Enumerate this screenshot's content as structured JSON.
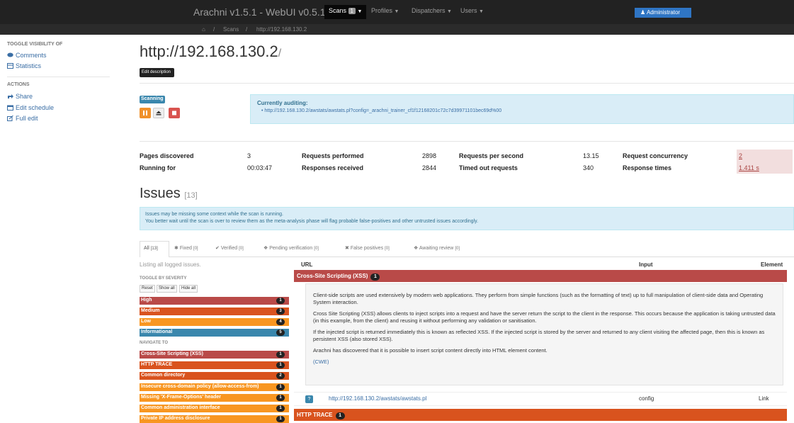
{
  "navbar": {
    "brand": "Arachni v1.5.1 - WebUI v0.5.12",
    "items": [
      {
        "label": "Scans",
        "badge": "1"
      },
      {
        "label": "Profiles"
      },
      {
        "label": "Dispatchers"
      },
      {
        "label": "Users"
      }
    ],
    "user": "Administrator"
  },
  "breadcrumb": [
    "Scans",
    "http://192.168.130.2"
  ],
  "sidebar": {
    "toggle_heading": "TOGGLE VISIBILITY OF",
    "toggle_items": [
      "Comments",
      "Statistics"
    ],
    "actions_heading": "ACTIONS",
    "actions": [
      "Share",
      "Edit schedule",
      "Full edit"
    ]
  },
  "scan": {
    "title": "http://192.168.130.2",
    "edit_description": "Edit description",
    "status": "Scanning",
    "auditing_heading": "Currently auditing:",
    "auditing_url": "http://192.168.130.2/awstats/awstats.pl?config=_arachni_trainer_cf1f12168201c72c7d39971101bec69d%00"
  },
  "stats": [
    {
      "label": "Pages discovered",
      "value": "3"
    },
    {
      "label": "Requests performed",
      "value": "2898"
    },
    {
      "label": "Requests per second",
      "value": "13.15"
    },
    {
      "label": "Request concurrency",
      "value": "2"
    },
    {
      "label": "Running for",
      "value": "00:03:47"
    },
    {
      "label": "Responses received",
      "value": "2844"
    },
    {
      "label": "Timed out requests",
      "value": "340"
    },
    {
      "label": "Response times",
      "value": "1.411 s"
    }
  ],
  "issues": {
    "heading": "Issues",
    "count": "[13]",
    "warning_line1": "Issues may be missing some context while the scan is running.",
    "warning_line2": "You better wait until the scan is over to review them as the meta-analysis phase will flag probable false-positives and other untrusted issues accordingly.",
    "tabs": [
      {
        "label": "All",
        "count": "[13]"
      },
      {
        "label": "Fixed",
        "count": "[0]"
      },
      {
        "label": "Verified",
        "count": "[0]"
      },
      {
        "label": "Pending verification",
        "count": "[0]"
      },
      {
        "label": "False positives",
        "count": "[0]"
      },
      {
        "label": "Awaiting review",
        "count": "[0]"
      }
    ],
    "listing_text": "Listing all logged issues.",
    "columns": [
      "URL",
      "Input",
      "Element"
    ],
    "severity_heading": "TOGGLE BY SEVERITY",
    "severity_buttons": [
      "Reset",
      "Show all",
      "Hide all"
    ],
    "severities": [
      {
        "label": "High",
        "count": "1"
      },
      {
        "label": "Medium",
        "count": "3"
      },
      {
        "label": "Low",
        "count": "4"
      },
      {
        "label": "Informational",
        "count": "5"
      }
    ],
    "navigate_heading": "NAVIGATE TO",
    "navigate": [
      {
        "label": "Cross-Site Scripting (XSS)",
        "count": "1"
      },
      {
        "label": "HTTP TRACE",
        "count": "1"
      },
      {
        "label": "Common directory",
        "count": "2"
      },
      {
        "label": "Insecure cross-domain policy (allow-access-from)",
        "count": "1"
      },
      {
        "label": "Missing 'X-Frame-Options' header",
        "count": "1"
      },
      {
        "label": "Common administration interface",
        "count": "1"
      },
      {
        "label": "Private IP address disclosure",
        "count": "1"
      }
    ],
    "groups": [
      {
        "title": "Cross-Site Scripting (XSS)",
        "count": "1",
        "description": [
          "Client-side scripts are used extensively by modern web applications. They perform from simple functions (such as the formatting of text) up to full manipulation of client-side data and Operating System interaction.",
          "Cross Site Scripting (XSS) allows clients to inject scripts into a request and have the server return the script to the client in the response. This occurs because the application is taking untrusted data (in this example, from the client) and reusing it without performing any validation or sanitisation.",
          "If the injected script is returned immediately this is known as reflected XSS. If the injected script is stored by the server and returned to any client visiting the affected page, then this is known as persistent XSS (also stored XSS).",
          "Arachni has discovered that it is possible to insert script content directly into HTML element content."
        ],
        "cwe_link": "(CWE)",
        "row": {
          "icon": "?",
          "url": "http://192.168.130.2/awstats/awstats.pl",
          "input": "config",
          "element": "Link"
        }
      },
      {
        "title": "HTTP TRACE",
        "count": "1"
      }
    ]
  },
  "colors": {
    "high": "#b94a48",
    "medium": "#d9531e",
    "low": "#f89621",
    "informational": "#3a87ad"
  }
}
